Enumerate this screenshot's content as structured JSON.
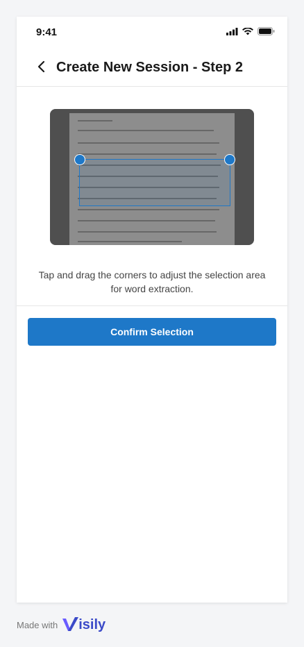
{
  "status_bar": {
    "time": "9:41",
    "icons": [
      "signal-icon",
      "wifi-icon",
      "battery-icon"
    ]
  },
  "header": {
    "back_icon": "chevron-left-icon",
    "title": "Create New Session - Step 2"
  },
  "crop": {
    "handles": [
      "top-left",
      "top-right"
    ]
  },
  "instruction": "Tap and drag the corners to adjust the selection area for word extraction.",
  "confirm_button": {
    "label": "Confirm Selection"
  },
  "footer": {
    "made_with": "Made with",
    "brand": "isily",
    "brand_mark": "V"
  },
  "colors": {
    "accent": "#1e78c8",
    "brand": "#3b4ac8"
  }
}
